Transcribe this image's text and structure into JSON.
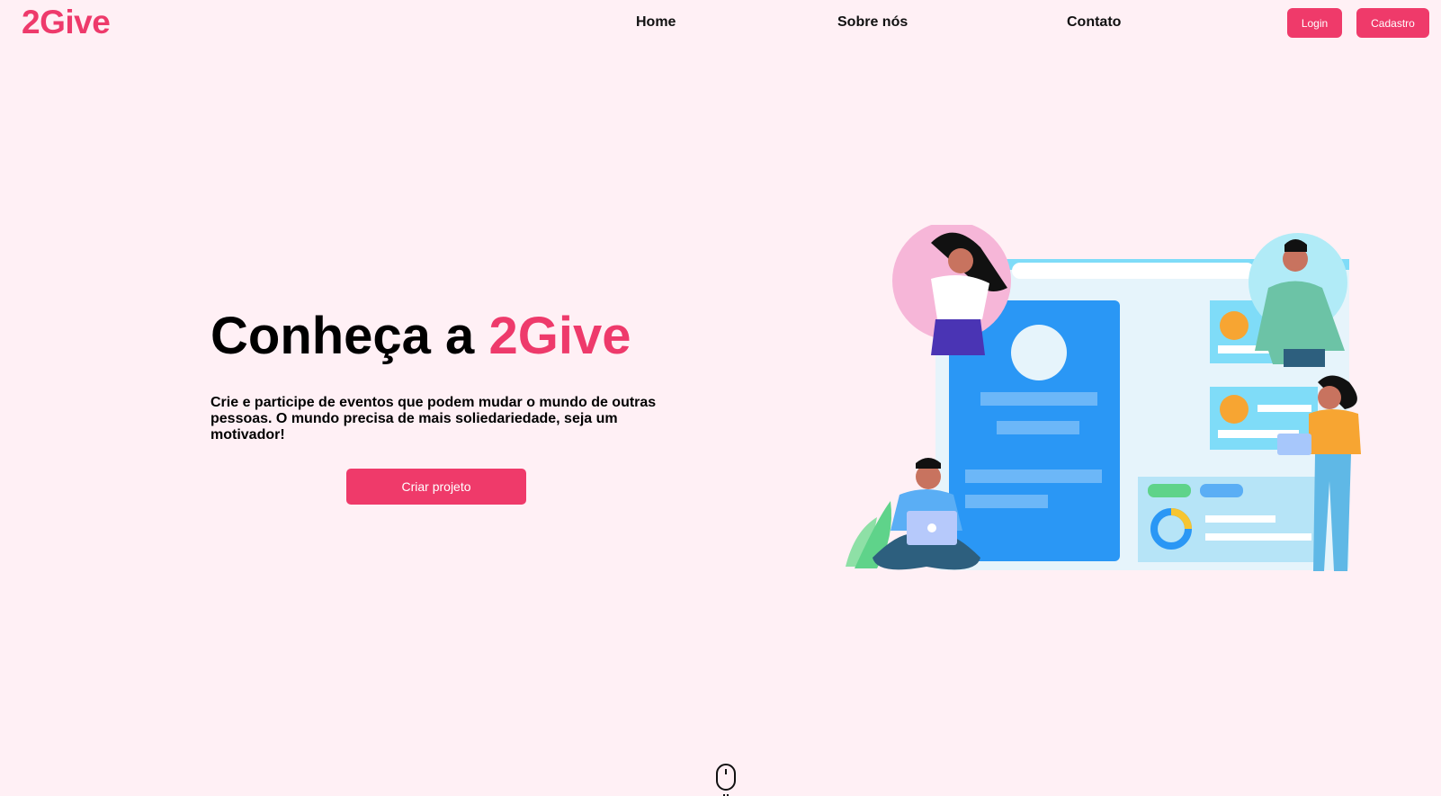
{
  "header": {
    "logo": "2Give",
    "nav": [
      {
        "label": "Home"
      },
      {
        "label": "Sobre nós"
      },
      {
        "label": "Contato"
      }
    ],
    "login_label": "Login",
    "signup_label": "Cadastro"
  },
  "hero": {
    "title_prefix": "Conheça a",
    "title_accent": "2Give",
    "description": "Crie e participe de eventos que podem mudar o mundo de outras pessoas. O mundo precisa de mais soliedariedade, seja um motivador!",
    "cta_label": "Criar projeto"
  },
  "icons": {
    "scroll": "mouse-icon"
  },
  "colors": {
    "background": "#fff0f5",
    "brand": "#ee3a6b",
    "button": "#ef3a6a"
  }
}
